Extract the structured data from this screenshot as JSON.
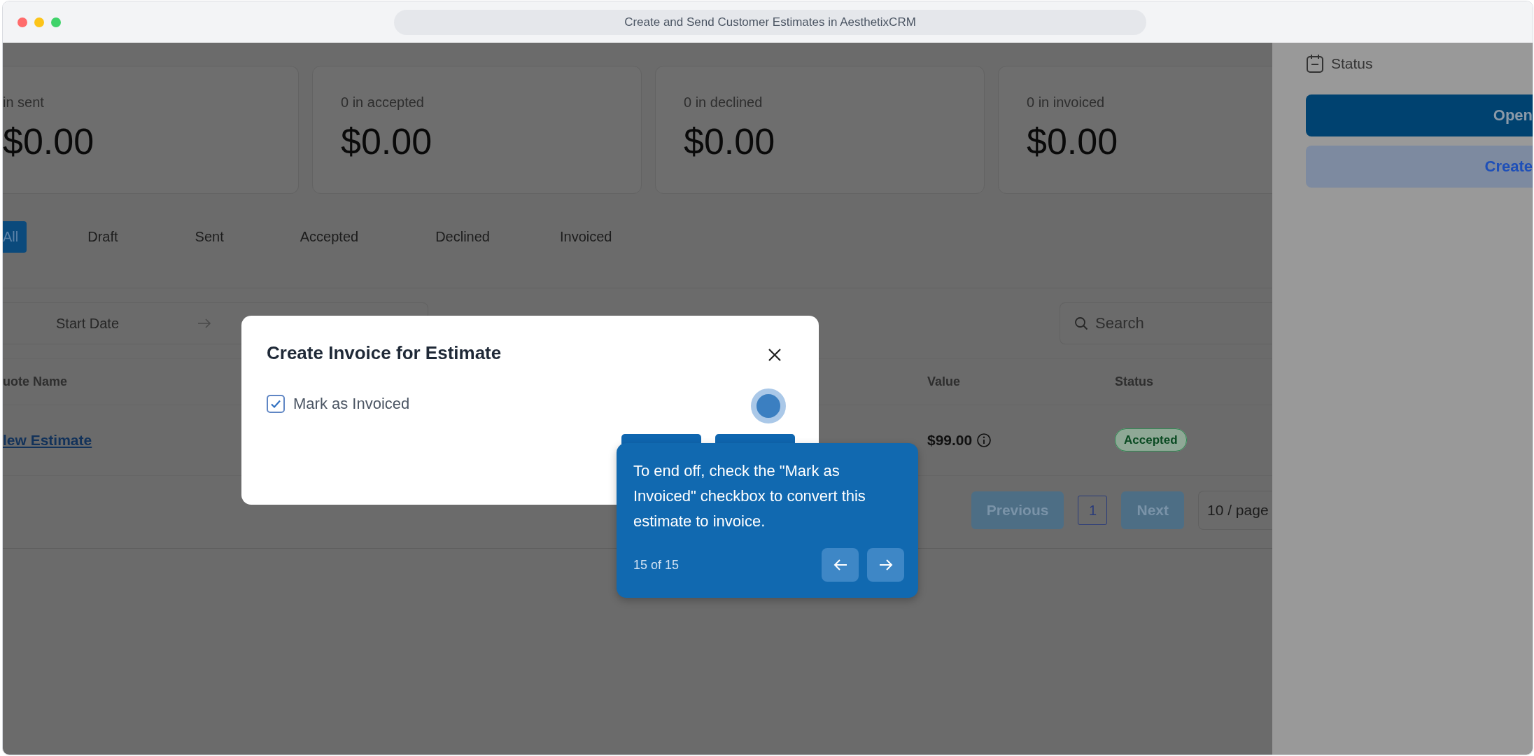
{
  "window": {
    "title": "Create and Send Customer Estimates in AesthetixCRM"
  },
  "summary_cards": [
    {
      "label": "in sent",
      "amount": "$0.00"
    },
    {
      "label": "0 in accepted",
      "amount": "$0.00"
    },
    {
      "label": "0 in declined",
      "amount": "$0.00"
    },
    {
      "label": "0 in invoiced",
      "amount": "$0.00"
    }
  ],
  "tabs": [
    {
      "label": "All",
      "selected": true
    },
    {
      "label": "Draft",
      "selected": false
    },
    {
      "label": "Sent",
      "selected": false
    },
    {
      "label": "Accepted",
      "selected": false
    },
    {
      "label": "Declined",
      "selected": false
    },
    {
      "label": "Invoiced",
      "selected": false
    }
  ],
  "filters": {
    "start_date": {
      "placeholder": "Start Date"
    },
    "search": {
      "placeholder": "Search"
    }
  },
  "table": {
    "columns": [
      "uote Name",
      "Value",
      "Status"
    ],
    "rows": [
      {
        "quote_name": "lew Estimate",
        "value": "$99.00",
        "status": "Accepted"
      }
    ]
  },
  "pagination": {
    "previous": "Previous",
    "pages": [
      {
        "label": "1",
        "selected": true
      }
    ],
    "next": "Next",
    "page_size": "10 / page"
  },
  "side_panel": {
    "heading": "Status",
    "buttons": [
      {
        "label": "Open",
        "kind": "primary"
      },
      {
        "label": "Create",
        "kind": "secondary"
      }
    ]
  },
  "dialog": {
    "title": "Create Invoice for Estimate",
    "checkbox": {
      "label": "Mark as Invoiced",
      "checked": true
    }
  },
  "tour_tooltip": {
    "text": "To end off, check the \"Mark as Invoiced\" checkbox to convert this estimate to invoice.",
    "step": "15 of 15"
  }
}
